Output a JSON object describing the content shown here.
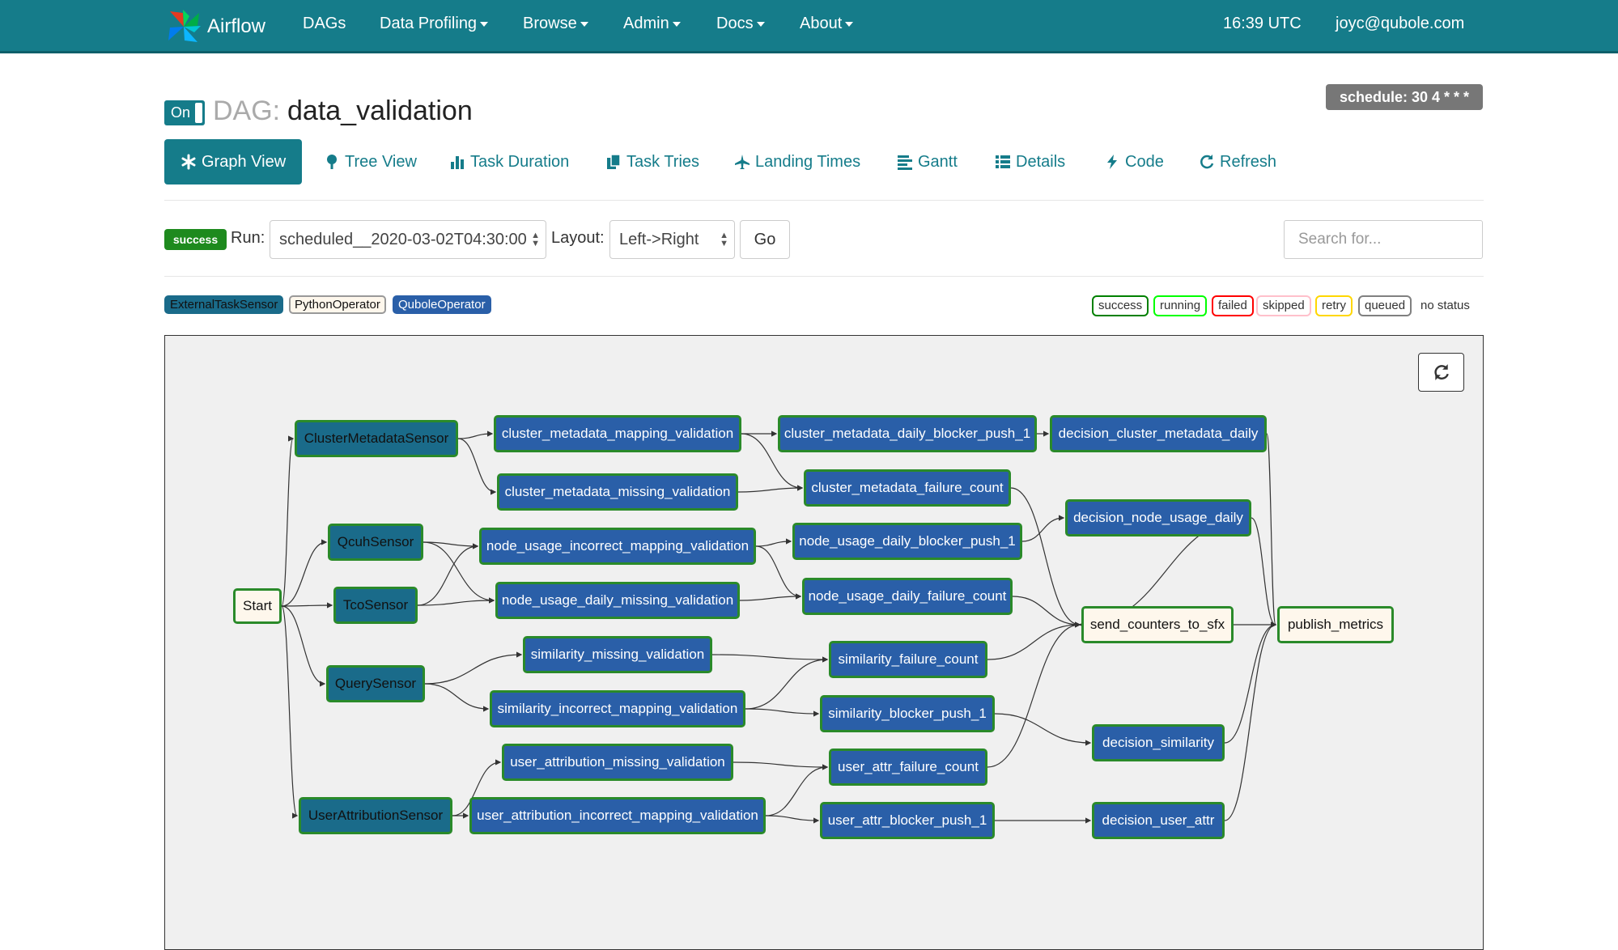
{
  "navbar": {
    "brand": "Airflow",
    "items": [
      "DAGs",
      "Data Profiling",
      "Browse",
      "Admin",
      "Docs",
      "About"
    ],
    "time": "16:39 UTC",
    "user": "joyc@qubole.com"
  },
  "header": {
    "toggle": "On",
    "dag_prefix": "DAG:",
    "dag_id": "data_validation",
    "schedule": "schedule: 30 4 * * *"
  },
  "tabs": [
    {
      "label": "Graph View",
      "icon": "asterisk-icon"
    },
    {
      "label": "Tree View",
      "icon": "tree-icon"
    },
    {
      "label": "Task Duration",
      "icon": "bar-chart-icon"
    },
    {
      "label": "Task Tries",
      "icon": "duplicate-icon"
    },
    {
      "label": "Landing Times",
      "icon": "plane-icon"
    },
    {
      "label": "Gantt",
      "icon": "align-left-icon"
    },
    {
      "label": "Details",
      "icon": "list-icon"
    },
    {
      "label": "Code",
      "icon": "flash-icon"
    },
    {
      "label": "Refresh",
      "icon": "refresh-icon"
    }
  ],
  "run_bar": {
    "state_badge": "success",
    "run_label": "Run:",
    "run_value": "scheduled__2020-03-02T04:30:00",
    "layout_label": "Layout:",
    "layout_value": "Left->Right",
    "go_label": "Go",
    "search_placeholder": "Search for..."
  },
  "operator_legend": [
    "ExternalTaskSensor",
    "PythonOperator",
    "QuboleOperator"
  ],
  "state_legend": [
    "success",
    "running",
    "failed",
    "skipped",
    "retry",
    "queued",
    "no status"
  ],
  "colors": {
    "navbar": "#157c8a",
    "success": "#008000",
    "running": "#00ff00",
    "failed": "#ff0000",
    "skipped": "#ffc0cb",
    "retry": "#ffd700",
    "queued": "#808080",
    "sensor": "#1a6b8a",
    "qubole": "#2a5fa8",
    "python": "#fef7ec"
  },
  "graph": {
    "nodes": [
      {
        "id": "Start",
        "type": "python"
      },
      {
        "id": "ClusterMetadataSensor",
        "type": "sensor"
      },
      {
        "id": "QcuhSensor",
        "type": "sensor"
      },
      {
        "id": "TcoSensor",
        "type": "sensor"
      },
      {
        "id": "QuerySensor",
        "type": "sensor"
      },
      {
        "id": "UserAttributionSensor",
        "type": "sensor"
      },
      {
        "id": "cluster_metadata_mapping_validation",
        "type": "qubole"
      },
      {
        "id": "cluster_metadata_missing_validation",
        "type": "qubole"
      },
      {
        "id": "node_usage_incorrect_mapping_validation",
        "type": "qubole"
      },
      {
        "id": "node_usage_daily_missing_validation",
        "type": "qubole"
      },
      {
        "id": "similarity_missing_validation",
        "type": "qubole"
      },
      {
        "id": "similarity_incorrect_mapping_validation",
        "type": "qubole"
      },
      {
        "id": "user_attribution_missing_validation",
        "type": "qubole"
      },
      {
        "id": "user_attribution_incorrect_mapping_validation",
        "type": "qubole"
      },
      {
        "id": "cluster_metadata_daily_blocker_push_1",
        "type": "qubole"
      },
      {
        "id": "cluster_metadata_failure_count",
        "type": "qubole"
      },
      {
        "id": "node_usage_daily_blocker_push_1",
        "type": "qubole"
      },
      {
        "id": "node_usage_daily_failure_count",
        "type": "qubole"
      },
      {
        "id": "similarity_failure_count",
        "type": "qubole"
      },
      {
        "id": "similarity_blocker_push_1",
        "type": "qubole"
      },
      {
        "id": "user_attr_failure_count",
        "type": "qubole"
      },
      {
        "id": "user_attr_blocker_push_1",
        "type": "qubole"
      },
      {
        "id": "decision_cluster_metadata_daily",
        "type": "qubole"
      },
      {
        "id": "decision_node_usage_daily",
        "type": "qubole"
      },
      {
        "id": "decision_similarity",
        "type": "qubole"
      },
      {
        "id": "decision_user_attr",
        "type": "qubole"
      },
      {
        "id": "send_counters_to_sfx",
        "type": "python"
      },
      {
        "id": "publish_metrics",
        "type": "python"
      }
    ],
    "edges": [
      [
        "Start",
        "ClusterMetadataSensor"
      ],
      [
        "Start",
        "QcuhSensor"
      ],
      [
        "Start",
        "TcoSensor"
      ],
      [
        "Start",
        "QuerySensor"
      ],
      [
        "Start",
        "UserAttributionSensor"
      ],
      [
        "ClusterMetadataSensor",
        "cluster_metadata_mapping_validation"
      ],
      [
        "ClusterMetadataSensor",
        "cluster_metadata_missing_validation"
      ],
      [
        "QcuhSensor",
        "node_usage_incorrect_mapping_validation"
      ],
      [
        "QcuhSensor",
        "node_usage_daily_missing_validation"
      ],
      [
        "TcoSensor",
        "node_usage_incorrect_mapping_validation"
      ],
      [
        "TcoSensor",
        "node_usage_daily_missing_validation"
      ],
      [
        "QuerySensor",
        "similarity_missing_validation"
      ],
      [
        "QuerySensor",
        "similarity_incorrect_mapping_validation"
      ],
      [
        "UserAttributionSensor",
        "user_attribution_missing_validation"
      ],
      [
        "UserAttributionSensor",
        "user_attribution_incorrect_mapping_validation"
      ],
      [
        "cluster_metadata_mapping_validation",
        "cluster_metadata_daily_blocker_push_1"
      ],
      [
        "cluster_metadata_mapping_validation",
        "cluster_metadata_failure_count"
      ],
      [
        "cluster_metadata_missing_validation",
        "cluster_metadata_failure_count"
      ],
      [
        "node_usage_incorrect_mapping_validation",
        "node_usage_daily_blocker_push_1"
      ],
      [
        "node_usage_incorrect_mapping_validation",
        "node_usage_daily_failure_count"
      ],
      [
        "node_usage_daily_missing_validation",
        "node_usage_daily_failure_count"
      ],
      [
        "similarity_missing_validation",
        "similarity_failure_count"
      ],
      [
        "similarity_incorrect_mapping_validation",
        "similarity_failure_count"
      ],
      [
        "similarity_incorrect_mapping_validation",
        "similarity_blocker_push_1"
      ],
      [
        "user_attribution_missing_validation",
        "user_attr_failure_count"
      ],
      [
        "user_attribution_incorrect_mapping_validation",
        "user_attr_failure_count"
      ],
      [
        "user_attribution_incorrect_mapping_validation",
        "user_attr_blocker_push_1"
      ],
      [
        "cluster_metadata_daily_blocker_push_1",
        "decision_cluster_metadata_daily"
      ],
      [
        "cluster_metadata_failure_count",
        "send_counters_to_sfx"
      ],
      [
        "node_usage_daily_blocker_push_1",
        "decision_node_usage_daily"
      ],
      [
        "node_usage_daily_failure_count",
        "send_counters_to_sfx"
      ],
      [
        "similarity_failure_count",
        "send_counters_to_sfx"
      ],
      [
        "similarity_blocker_push_1",
        "decision_similarity"
      ],
      [
        "user_attr_failure_count",
        "send_counters_to_sfx"
      ],
      [
        "user_attr_blocker_push_1",
        "decision_user_attr"
      ],
      [
        "decision_cluster_metadata_daily",
        "publish_metrics"
      ],
      [
        "decision_node_usage_daily",
        "send_counters_to_sfx"
      ],
      [
        "decision_node_usage_daily",
        "publish_metrics"
      ],
      [
        "decision_similarity",
        "publish_metrics"
      ],
      [
        "decision_user_attr",
        "publish_metrics"
      ],
      [
        "send_counters_to_sfx",
        "publish_metrics"
      ]
    ]
  }
}
